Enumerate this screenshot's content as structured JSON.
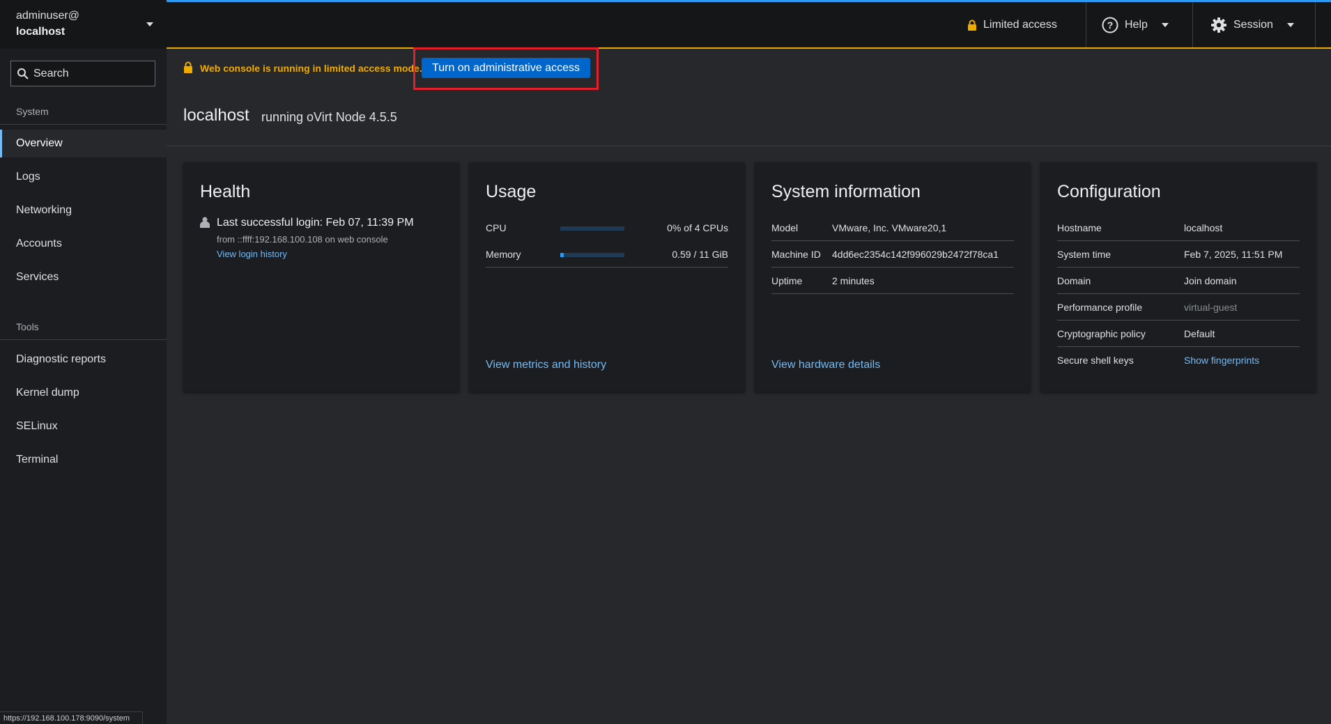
{
  "host": {
    "user": "adminuser@",
    "name": "localhost"
  },
  "search": {
    "label": "Search"
  },
  "nav": {
    "system_section": "System",
    "system_items": [
      "Overview",
      "Logs",
      "Networking",
      "Accounts",
      "Services"
    ],
    "tools_section": "Tools",
    "tools_items": [
      "Diagnostic reports",
      "Kernel dump",
      "SELinux",
      "Terminal"
    ],
    "active": "Overview"
  },
  "topbar": {
    "limited_access": "Limited access",
    "help": "Help",
    "session": "Session",
    "accent_color": "#2b9af3",
    "warning_color": "#f0ab00"
  },
  "alert": {
    "message": "Web console is running in limited access mode.",
    "button": "Turn on administrative access"
  },
  "page": {
    "title": "localhost",
    "subtitle": "running oVirt Node 4.5.5"
  },
  "health": {
    "title": "Health",
    "login_line": "Last successful login: Feb 07, 11:39 PM",
    "login_from": "from ::ffff:192.168.100.108 on web console",
    "history_link": "View login history"
  },
  "usage": {
    "title": "Usage",
    "cpu_label": "CPU",
    "cpu_value": "0% of 4 CPUs",
    "cpu_fraction": 0.0,
    "memory_label": "Memory",
    "memory_value": "0.59 / 11 GiB",
    "memory_fraction": 0.05,
    "link": "View metrics and history"
  },
  "sysinfo": {
    "title": "System information",
    "rows": [
      {
        "label": "Model",
        "value": "VMware, Inc. VMware20,1"
      },
      {
        "label": "Machine ID",
        "value": "4dd6ec2354c142f996029b2472f78ca1"
      },
      {
        "label": "Uptime",
        "value": "2 minutes"
      }
    ],
    "link": "View hardware details"
  },
  "config": {
    "title": "Configuration",
    "rows": [
      {
        "label": "Hostname",
        "value": "localhost"
      },
      {
        "label": "System time",
        "value": "Feb 7, 2025, 11:51 PM"
      },
      {
        "label": "Domain",
        "value": "Join domain"
      },
      {
        "label": "Performance profile",
        "value": "virtual-guest"
      },
      {
        "label": "Cryptographic policy",
        "value": "Default"
      },
      {
        "label": "Secure shell keys",
        "value": "Show fingerprints"
      }
    ]
  },
  "status_url": "https://192.168.100.178:9090/system"
}
